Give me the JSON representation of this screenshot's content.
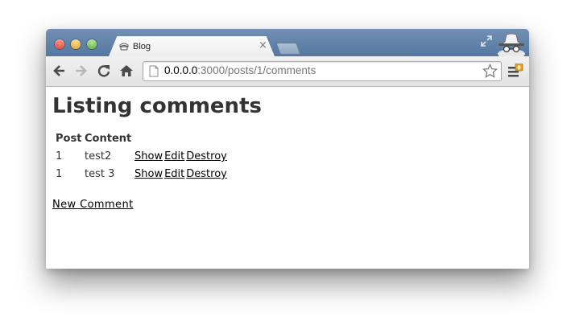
{
  "browser": {
    "tab": {
      "title": "Blog",
      "close_label": "×"
    },
    "toolbar": {
      "back_icon": "back-arrow-icon",
      "forward_icon": "forward-arrow-icon",
      "reload_icon": "reload-icon",
      "home_icon": "home-icon",
      "menu_icon": "wrench-menu-icon"
    },
    "address": {
      "host": "0.0.0.0",
      "rest": ":3000/posts/1/comments"
    }
  },
  "page": {
    "title": "Listing comments",
    "table": {
      "headers": [
        "Post",
        "Content"
      ],
      "rows": [
        {
          "post": "1",
          "content": "test2",
          "actions": [
            "Show",
            "Edit",
            "Destroy"
          ]
        },
        {
          "post": "1",
          "content": "test 3",
          "actions": [
            "Show",
            "Edit",
            "Destroy"
          ]
        }
      ]
    },
    "new_link": "New Comment"
  },
  "colors": {
    "titlebar": "#5f80a8",
    "toolbar": "#e8e8e8",
    "text": "#333333",
    "link": "#000000"
  }
}
